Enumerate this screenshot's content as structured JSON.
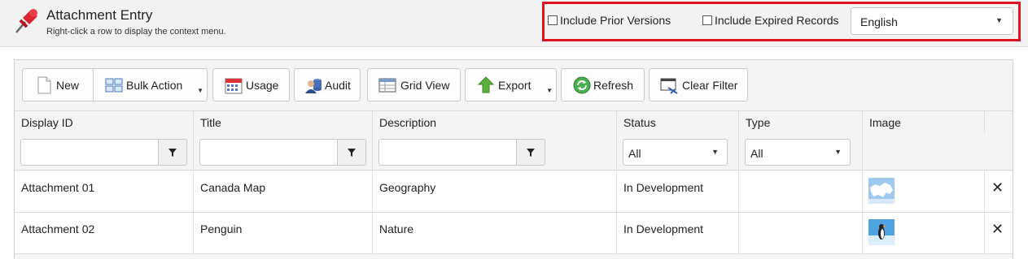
{
  "header": {
    "title": "Attachment Entry",
    "subtitle": "Right-click a row to display the context menu.",
    "include_prior_versions": "Include Prior Versions",
    "include_expired_records": "Include Expired Records",
    "language": "English"
  },
  "toolbar": {
    "new": "New",
    "bulk_action": "Bulk Action",
    "usage": "Usage",
    "audit": "Audit",
    "grid_view": "Grid View",
    "export": "Export",
    "refresh": "Refresh",
    "clear_filter": "Clear Filter"
  },
  "table": {
    "columns": [
      "Display ID",
      "Title",
      "Description",
      "Status",
      "Type",
      "Image"
    ],
    "filters": {
      "status": "All",
      "type": "All"
    },
    "rows": [
      {
        "display_id": "Attachment 01",
        "title": "Canada Map",
        "description": "Geography",
        "status": "In Development",
        "type": "",
        "image_icon": "map-thumbnail"
      },
      {
        "display_id": "Attachment 02",
        "title": "Penguin",
        "description": "Nature",
        "status": "In Development",
        "type": "",
        "image_icon": "penguin-thumbnail"
      }
    ]
  },
  "colors": {
    "highlight_border": "#e0141e",
    "pin_red": "#d9232d"
  }
}
